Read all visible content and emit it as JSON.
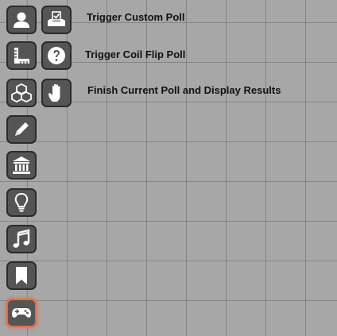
{
  "toolbar": {
    "tools": [
      {
        "icon": "person-icon"
      },
      {
        "icon": "ruler-icon"
      },
      {
        "icon": "blocks-icon"
      },
      {
        "icon": "pencil-icon"
      },
      {
        "icon": "bank-icon"
      },
      {
        "icon": "lightbulb-icon"
      },
      {
        "icon": "music-icon"
      },
      {
        "icon": "bookmark-icon"
      },
      {
        "icon": "gamepad-icon",
        "active": true
      }
    ]
  },
  "poll_menu": {
    "items": [
      {
        "icon": "ballot-icon",
        "label": "Trigger Custom Poll"
      },
      {
        "icon": "question-icon",
        "label": "Trigger Coil Flip Poll"
      },
      {
        "icon": "hand-icon",
        "label": "Finish Current Poll and Display Results"
      }
    ]
  },
  "colors": {
    "button": "#555555",
    "border": "#2b2b2b",
    "active_glow": "#e86a48",
    "canvas": "#a7a7a7"
  }
}
